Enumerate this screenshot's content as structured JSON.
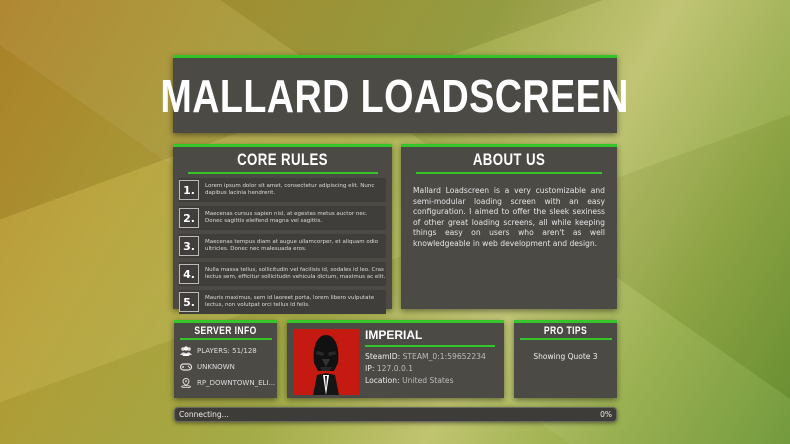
{
  "title": "MALLARD LOADSCREEN",
  "core_rules": {
    "heading": "CORE RULES",
    "rules": [
      {
        "number": "1.",
        "text": "Lorem ipsum dolor sit amet, consectetur adipiscing elit. Nunc dapibus lacinia hendrerit."
      },
      {
        "number": "2.",
        "text": "Maecenas cursus sapien nisl, at egestas metus auctor nec. Donec sagittis eleifend magna vel sagittis."
      },
      {
        "number": "3.",
        "text": "Maecenas tempus diam at augue ullamcorper, et aliquam odio ultricies. Donec nec malesuada eros."
      },
      {
        "number": "4.",
        "text": "Nulla massa tellus, sollicitudin vel facilisis id, sodales id leo. Cras lectus sem, efficitur sollicitudin vehicula dictum, maximus ac elit."
      },
      {
        "number": "5.",
        "text": "Mauris maximus, sem id laoreet porta, lorem libero vulputate lectus, non volutpat orci tellus id felis."
      }
    ]
  },
  "about": {
    "heading": "ABOUT US",
    "text": "Mallard Loadscreen is a very customizable and semi-modular loading screen with an easy configuration. I aimed to offer the sleek sexiness of other great loading screens, all while keeping things easy on users who aren't as well knowledgeable in web development and design."
  },
  "server_info": {
    "heading": "SERVER INFO",
    "players": "PLAYERS: 51/128",
    "gamemode": "UNKNOWN",
    "map": "RP_DOWNTOWN_ELI...",
    "icons": [
      "users-icon",
      "gamepad-icon",
      "map-pin-icon"
    ]
  },
  "player": {
    "name": "IMPERIAL",
    "steamid_label": "SteamID:",
    "steamid": "STEAM_0:1:59652234",
    "ip_label": "IP:",
    "ip": "127.0.0.1",
    "location_label": "Location:",
    "location": "United States",
    "avatar": "darth-vader-avatar"
  },
  "pro_tips": {
    "heading": "PRO TIPS",
    "text": "Showing Quote 3"
  },
  "progress": {
    "status": "Connecting...",
    "percent_label": "0%",
    "value": 0
  },
  "colors": {
    "accent": "#35c42a",
    "panel": "#4b4a45",
    "avatar_bg": "#c41a12"
  }
}
